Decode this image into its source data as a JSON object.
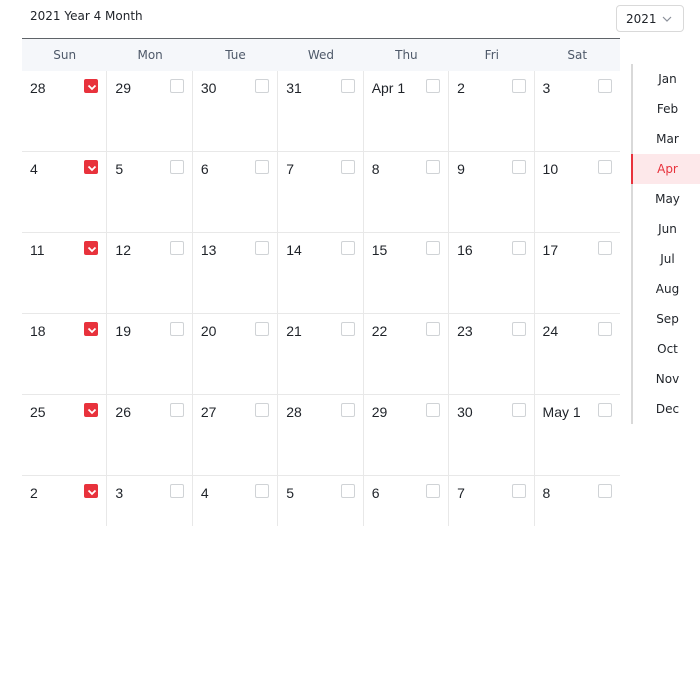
{
  "header": {
    "title": "2021 Year 4 Month"
  },
  "year_select": {
    "value": "2021"
  },
  "weekdays": [
    "Sun",
    "Mon",
    "Tue",
    "Wed",
    "Thu",
    "Fri",
    "Sat"
  ],
  "weeks": [
    [
      {
        "label": "28",
        "checked": true
      },
      {
        "label": "29",
        "checked": false
      },
      {
        "label": "30",
        "checked": false
      },
      {
        "label": "31",
        "checked": false
      },
      {
        "label": "Apr 1",
        "checked": false
      },
      {
        "label": "2",
        "checked": false
      },
      {
        "label": "3",
        "checked": false
      }
    ],
    [
      {
        "label": "4",
        "checked": true
      },
      {
        "label": "5",
        "checked": false
      },
      {
        "label": "6",
        "checked": false
      },
      {
        "label": "7",
        "checked": false
      },
      {
        "label": "8",
        "checked": false
      },
      {
        "label": "9",
        "checked": false
      },
      {
        "label": "10",
        "checked": false
      }
    ],
    [
      {
        "label": "11",
        "checked": true
      },
      {
        "label": "12",
        "checked": false
      },
      {
        "label": "13",
        "checked": false
      },
      {
        "label": "14",
        "checked": false
      },
      {
        "label": "15",
        "checked": false
      },
      {
        "label": "16",
        "checked": false
      },
      {
        "label": "17",
        "checked": false
      }
    ],
    [
      {
        "label": "18",
        "checked": true
      },
      {
        "label": "19",
        "checked": false
      },
      {
        "label": "20",
        "checked": false
      },
      {
        "label": "21",
        "checked": false
      },
      {
        "label": "22",
        "checked": false
      },
      {
        "label": "23",
        "checked": false
      },
      {
        "label": "24",
        "checked": false
      }
    ],
    [
      {
        "label": "25",
        "checked": true
      },
      {
        "label": "26",
        "checked": false
      },
      {
        "label": "27",
        "checked": false
      },
      {
        "label": "28",
        "checked": false
      },
      {
        "label": "29",
        "checked": false
      },
      {
        "label": "30",
        "checked": false
      },
      {
        "label": "May 1",
        "checked": false
      }
    ],
    [
      {
        "label": "2",
        "checked": true
      },
      {
        "label": "3",
        "checked": false
      },
      {
        "label": "4",
        "checked": false
      },
      {
        "label": "5",
        "checked": false
      },
      {
        "label": "6",
        "checked": false
      },
      {
        "label": "7",
        "checked": false
      },
      {
        "label": "8",
        "checked": false
      }
    ]
  ],
  "months": [
    "Jan",
    "Feb",
    "Mar",
    "Apr",
    "May",
    "Jun",
    "Jul",
    "Aug",
    "Sep",
    "Oct",
    "Nov",
    "Dec"
  ],
  "active_month": "Apr",
  "colors": {
    "accent": "#e8323c",
    "accent_bg": "#fde8ea",
    "header_bg": "#f5f7fa"
  }
}
